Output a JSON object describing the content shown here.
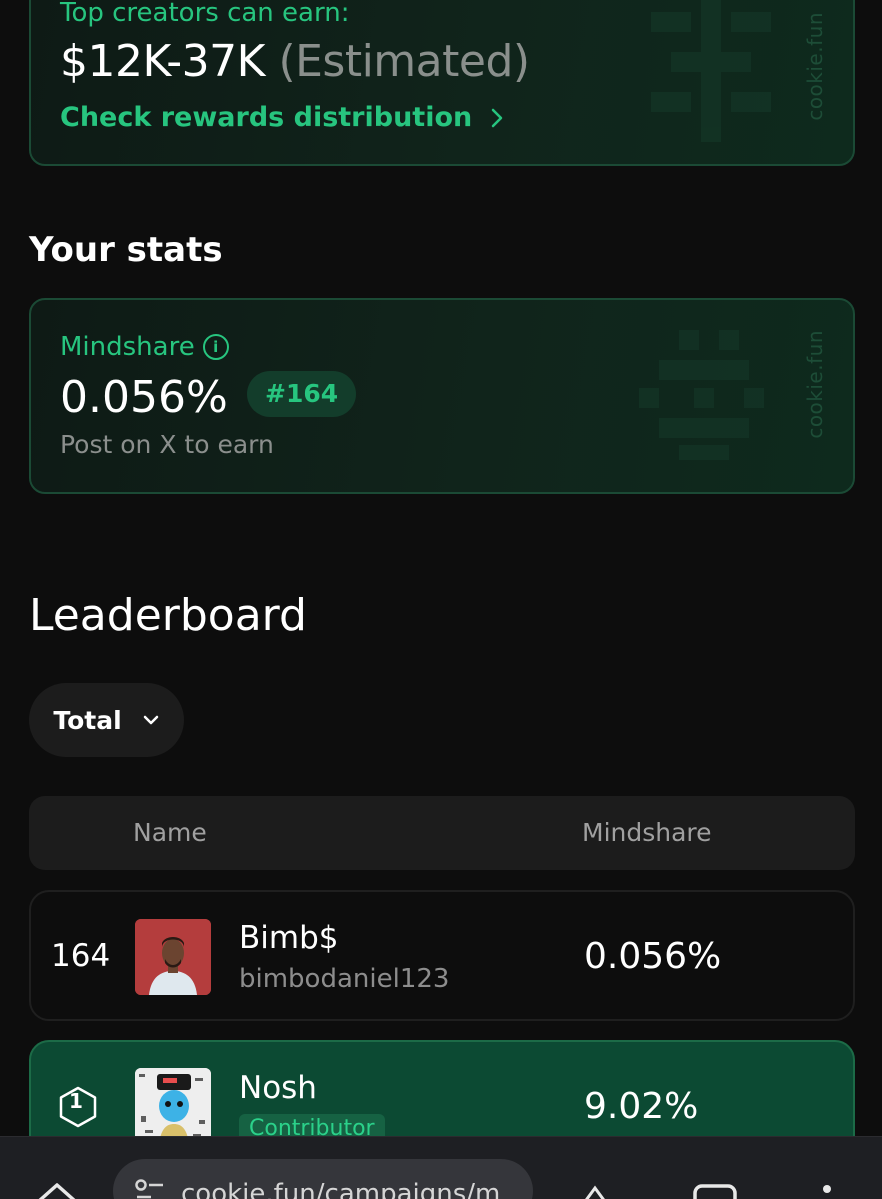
{
  "rewards": {
    "label": "Top creators can earn:",
    "amount": "$12K-37K",
    "amount_note": "(Estimated)",
    "link": "Check rewards distribution",
    "watermark": "cookie.fun"
  },
  "stats": {
    "title": "Your stats",
    "mindshare_label": "Mindshare",
    "mindshare_value": "0.056%",
    "rank": "#164",
    "hint": "Post on X to earn",
    "watermark": "cookie.fun"
  },
  "leaderboard": {
    "title": "Leaderboard",
    "filter": "Total",
    "columns": {
      "name": "Name",
      "mindshare": "Mindshare"
    },
    "rows": [
      {
        "rank": "164",
        "name": "Bimb$",
        "handle": "bimbodaniel123",
        "mindshare": "0.056%"
      },
      {
        "rank": "1",
        "name": "Nosh",
        "tag": "Contributor",
        "mindshare": "9.02%"
      }
    ]
  },
  "browser": {
    "url": "cookie.fun/campaigns/m"
  },
  "colors": {
    "accent": "#27c57f",
    "background": "#0d0d0d",
    "highlight_row": "#0c4a33"
  }
}
